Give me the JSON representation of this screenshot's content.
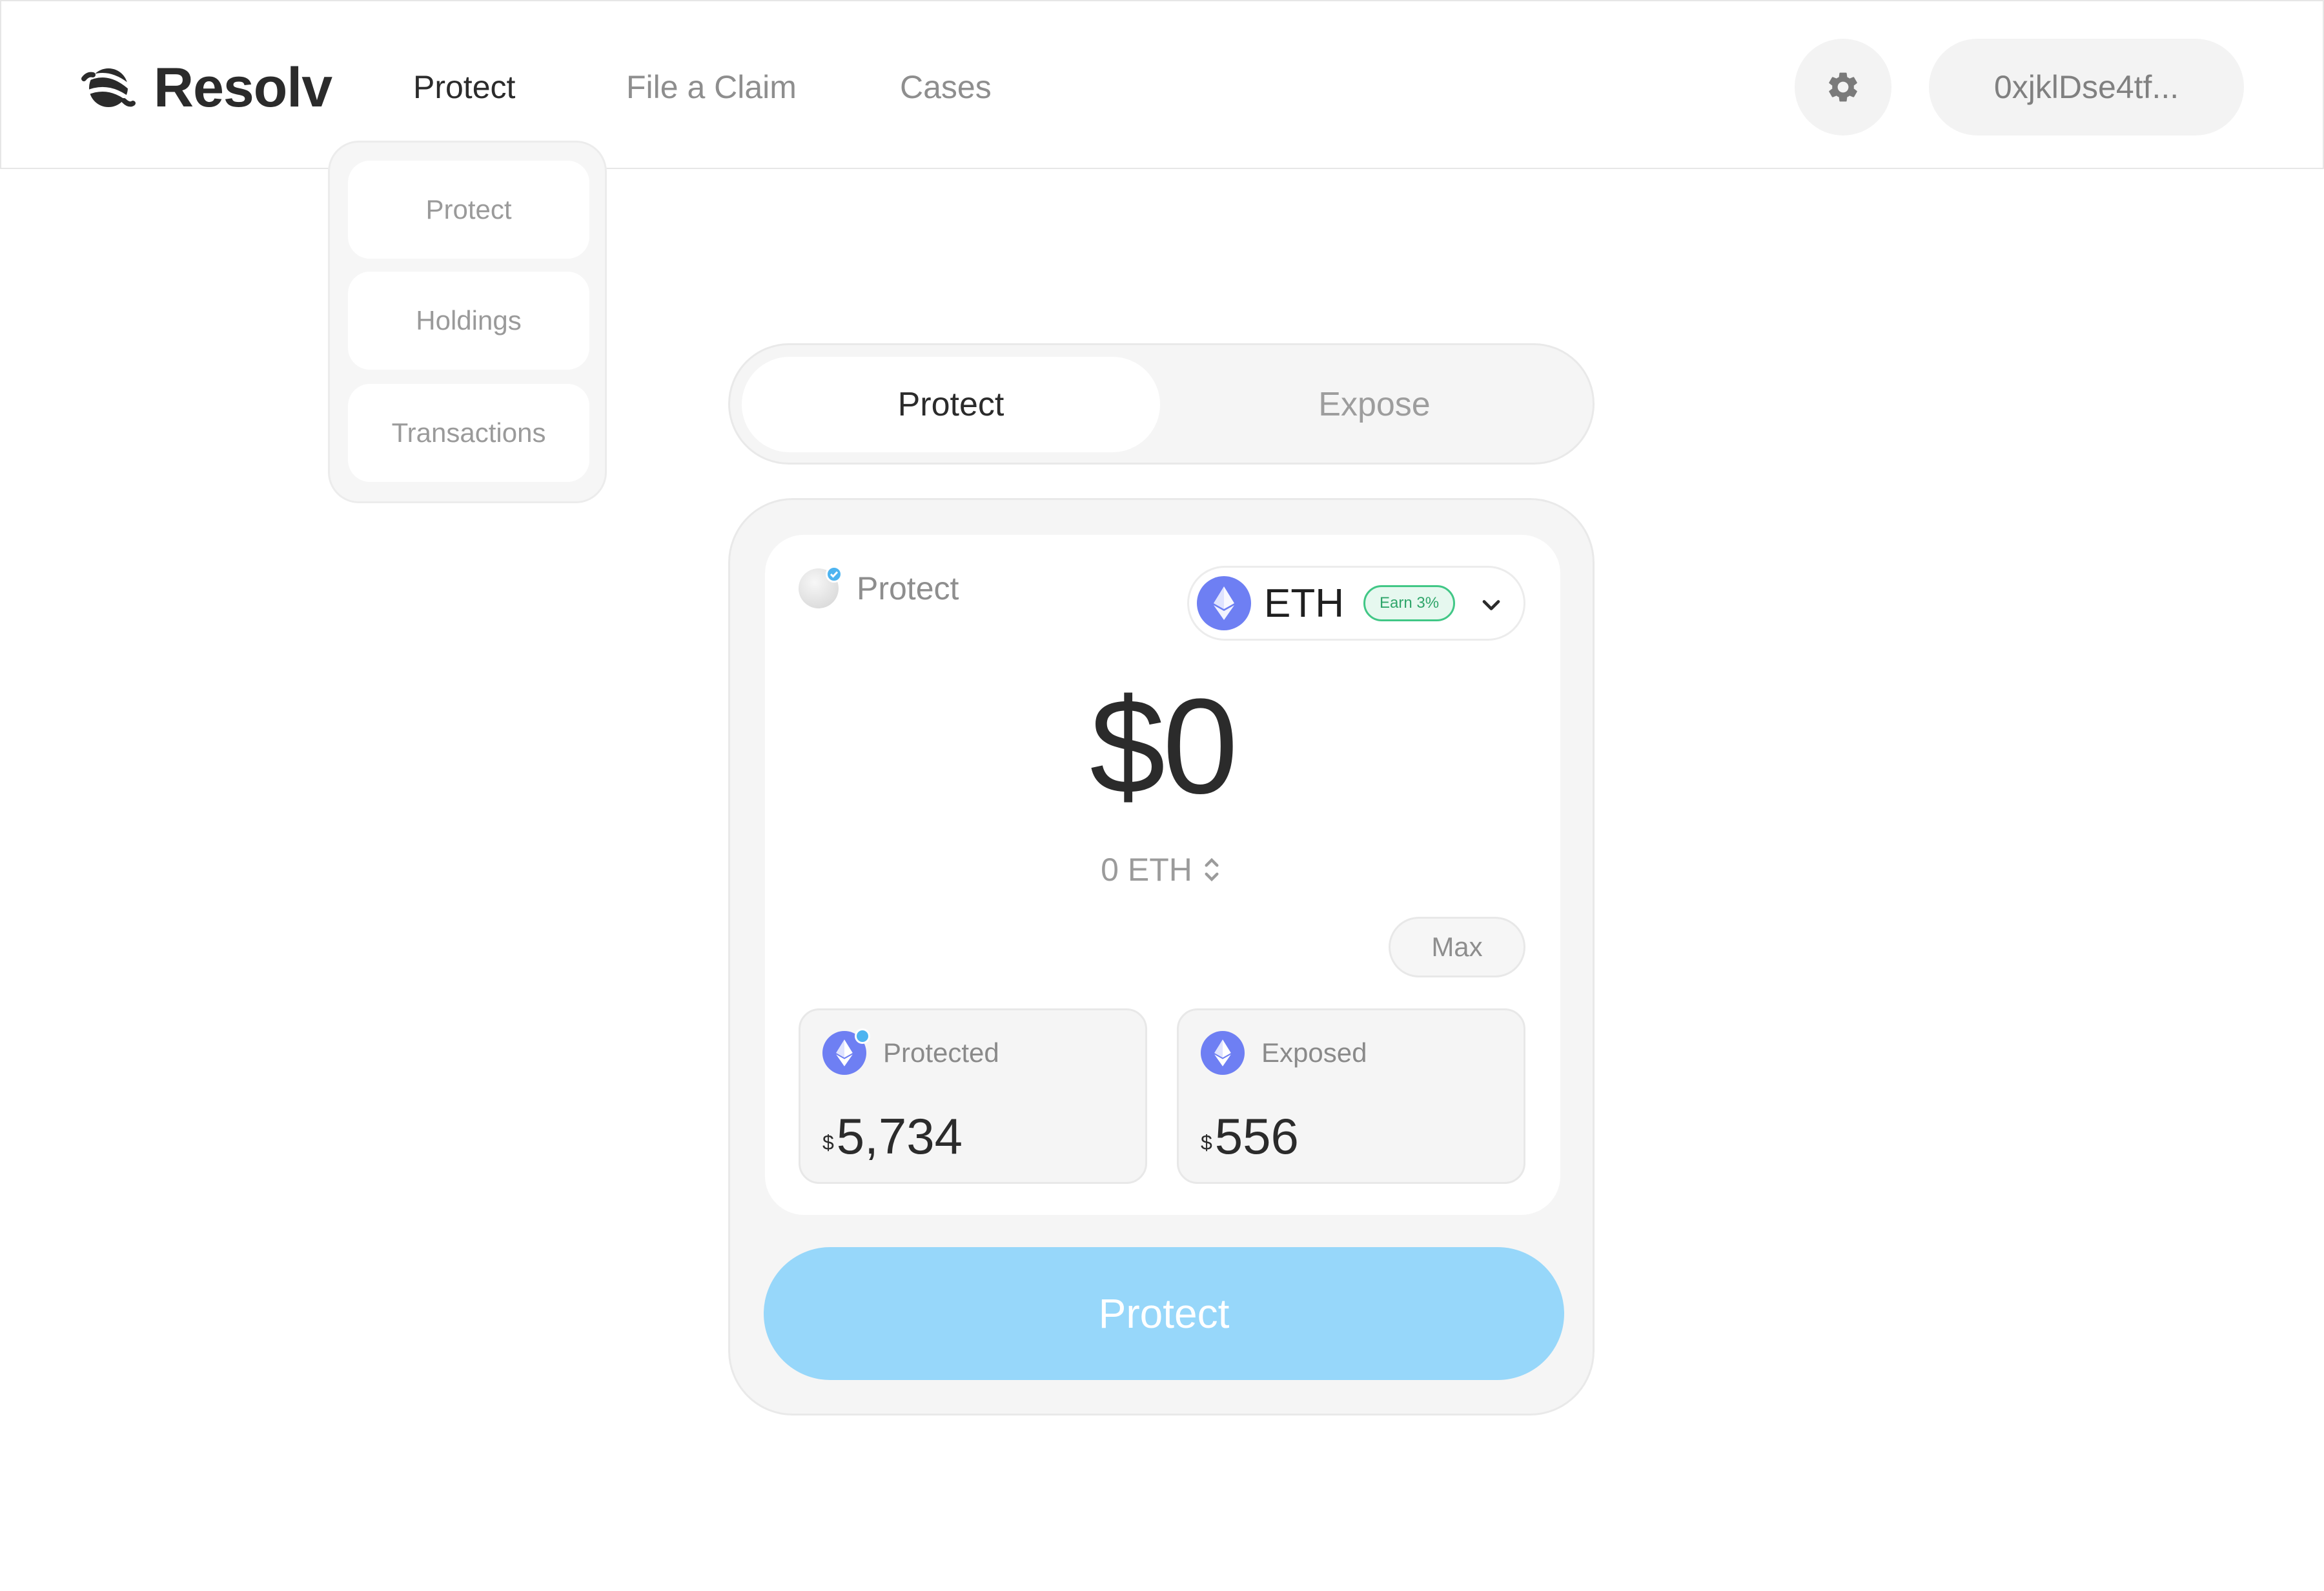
{
  "header": {
    "brand": "Resolv",
    "nav": [
      {
        "label": "Protect",
        "active": true
      },
      {
        "label": "File a Claim",
        "active": false
      },
      {
        "label": "Cases",
        "active": false
      }
    ],
    "settings_icon": "gear-icon",
    "wallet_address": "0xjklDse4tf..."
  },
  "submenu": {
    "items": [
      "Protect",
      "Holdings",
      "Transactions"
    ]
  },
  "mode_toggle": {
    "options": [
      "Protect",
      "Expose"
    ],
    "active": "Protect"
  },
  "card": {
    "section_label": "Protect",
    "asset": {
      "symbol": "ETH",
      "earn_badge": "Earn 3%",
      "icon": "ethereum-icon"
    },
    "amount_usd": "$0",
    "amount_token": "0 ETH",
    "max_label": "Max",
    "stats": [
      {
        "label": "Protected",
        "currency": "$",
        "value": "5,734",
        "verified": true
      },
      {
        "label": "Exposed",
        "currency": "$",
        "value": "556",
        "verified": false
      }
    ],
    "cta_label": "Protect"
  },
  "colors": {
    "cta_bg": "#97d7fa",
    "eth_icon": "#6e7ff3",
    "earn_green": "#41c786",
    "verified_blue": "#4db4f0"
  }
}
